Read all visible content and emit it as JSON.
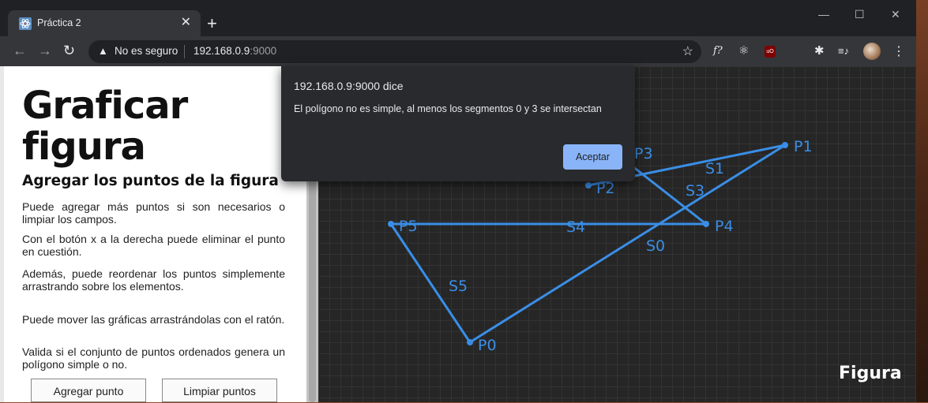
{
  "browser": {
    "tab_title": "Práctica 2",
    "tab_close": "✕",
    "new_tab": "+",
    "security_label": "No es seguro",
    "url_host": "192.168.0.9",
    "url_port": ":9000",
    "window_controls": [
      "—",
      "☐",
      "✕"
    ],
    "extensions": [
      "f?",
      "⚛",
      "uO",
      "✱",
      "≡♪"
    ]
  },
  "page": {
    "title_line1": "Graficar",
    "title_line2": "figura",
    "subtitle": "Agregar los puntos de la figura",
    "paragraphs": [
      "Puede agregar más puntos si son necesarios o limpiar los campos.",
      "Con el botón x a la derecha puede eliminar el punto en cuestión.",
      "Además, puede reordenar los puntos simplemente arrastrando sobre los elementos.",
      "Puede mover las gráficas arrastrándolas con el ratón.",
      "Valida si el conjunto de puntos ordenados genera un polígono simple o no."
    ],
    "add_button": "Agregar punto",
    "clear_button": "Limpiar puntos"
  },
  "figure": {
    "label": "Figura",
    "line_color": "#3a8ee6",
    "points": [
      {
        "name": "P0"
      },
      {
        "name": "P1"
      },
      {
        "name": "P2"
      },
      {
        "name": "P3"
      },
      {
        "name": "P4"
      },
      {
        "name": "P5"
      }
    ],
    "segments": [
      {
        "name": "S0",
        "from": "P0",
        "to": "P1"
      },
      {
        "name": "S1",
        "from": "P1",
        "to": "P2"
      },
      {
        "name": "S3",
        "from": "P3",
        "to": "P4"
      },
      {
        "name": "S4",
        "from": "P4",
        "to": "P5"
      },
      {
        "name": "S5",
        "from": "P5",
        "to": "P0"
      }
    ]
  },
  "dialog": {
    "origin": "192.168.0.9:9000 dice",
    "message": "El polígono no es simple, al menos los segmentos 0 y 3 se intersectan",
    "ok_button": "Aceptar",
    "button_color": "#8ab4f8"
  }
}
